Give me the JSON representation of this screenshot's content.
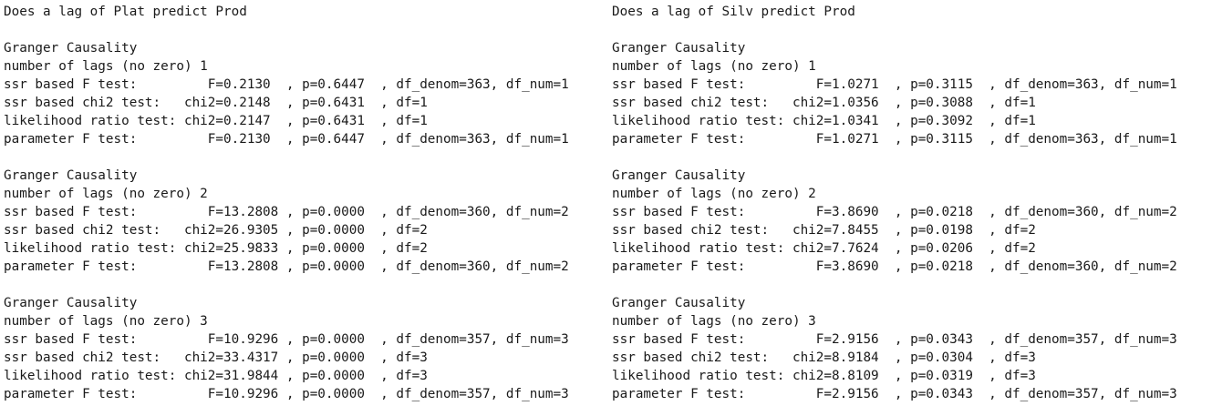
{
  "panels": [
    {
      "heading": "Does a lag of Plat predict Prod",
      "blocks": [
        {
          "title": "Granger Causality",
          "lags_line": "number of lags (no zero) 1",
          "rows": [
            "ssr based F test:         F=0.2130  , p=0.6447  , df_denom=363, df_num=1",
            "ssr based chi2 test:   chi2=0.2148  , p=0.6431  , df=1",
            "likelihood ratio test: chi2=0.2147  , p=0.6431  , df=1",
            "parameter F test:         F=0.2130  , p=0.6447  , df_denom=363, df_num=1"
          ]
        },
        {
          "title": "Granger Causality",
          "lags_line": "number of lags (no zero) 2",
          "rows": [
            "ssr based F test:         F=13.2808 , p=0.0000  , df_denom=360, df_num=2",
            "ssr based chi2 test:   chi2=26.9305 , p=0.0000  , df=2",
            "likelihood ratio test: chi2=25.9833 , p=0.0000  , df=2",
            "parameter F test:         F=13.2808 , p=0.0000  , df_denom=360, df_num=2"
          ]
        },
        {
          "title": "Granger Causality",
          "lags_line": "number of lags (no zero) 3",
          "rows": [
            "ssr based F test:         F=10.9296 , p=0.0000  , df_denom=357, df_num=3",
            "ssr based chi2 test:   chi2=33.4317 , p=0.0000  , df=3",
            "likelihood ratio test: chi2=31.9844 , p=0.0000  , df=3",
            "parameter F test:         F=10.9296 , p=0.0000  , df_denom=357, df_num=3"
          ]
        }
      ]
    },
    {
      "heading": "Does a lag of Silv predict Prod",
      "blocks": [
        {
          "title": "Granger Causality",
          "lags_line": "number of lags (no zero) 1",
          "rows": [
            "ssr based F test:         F=1.0271  , p=0.3115  , df_denom=363, df_num=1",
            "ssr based chi2 test:   chi2=1.0356  , p=0.3088  , df=1",
            "likelihood ratio test: chi2=1.0341  , p=0.3092  , df=1",
            "parameter F test:         F=1.0271  , p=0.3115  , df_denom=363, df_num=1"
          ]
        },
        {
          "title": "Granger Causality",
          "lags_line": "number of lags (no zero) 2",
          "rows": [
            "ssr based F test:         F=3.8690  , p=0.0218  , df_denom=360, df_num=2",
            "ssr based chi2 test:   chi2=7.8455  , p=0.0198  , df=2",
            "likelihood ratio test: chi2=7.7624  , p=0.0206  , df=2",
            "parameter F test:         F=3.8690  , p=0.0218  , df_denom=360, df_num=2"
          ]
        },
        {
          "title": "Granger Causality",
          "lags_line": "number of lags (no zero) 3",
          "rows": [
            "ssr based F test:         F=2.9156  , p=0.0343  , df_denom=357, df_num=3",
            "ssr based chi2 test:   chi2=8.9184  , p=0.0304  , df=3",
            "likelihood ratio test: chi2=8.8109  , p=0.0319  , df=3",
            "parameter F test:         F=2.9156  , p=0.0343  , df_denom=357, df_num=3"
          ]
        }
      ]
    }
  ]
}
